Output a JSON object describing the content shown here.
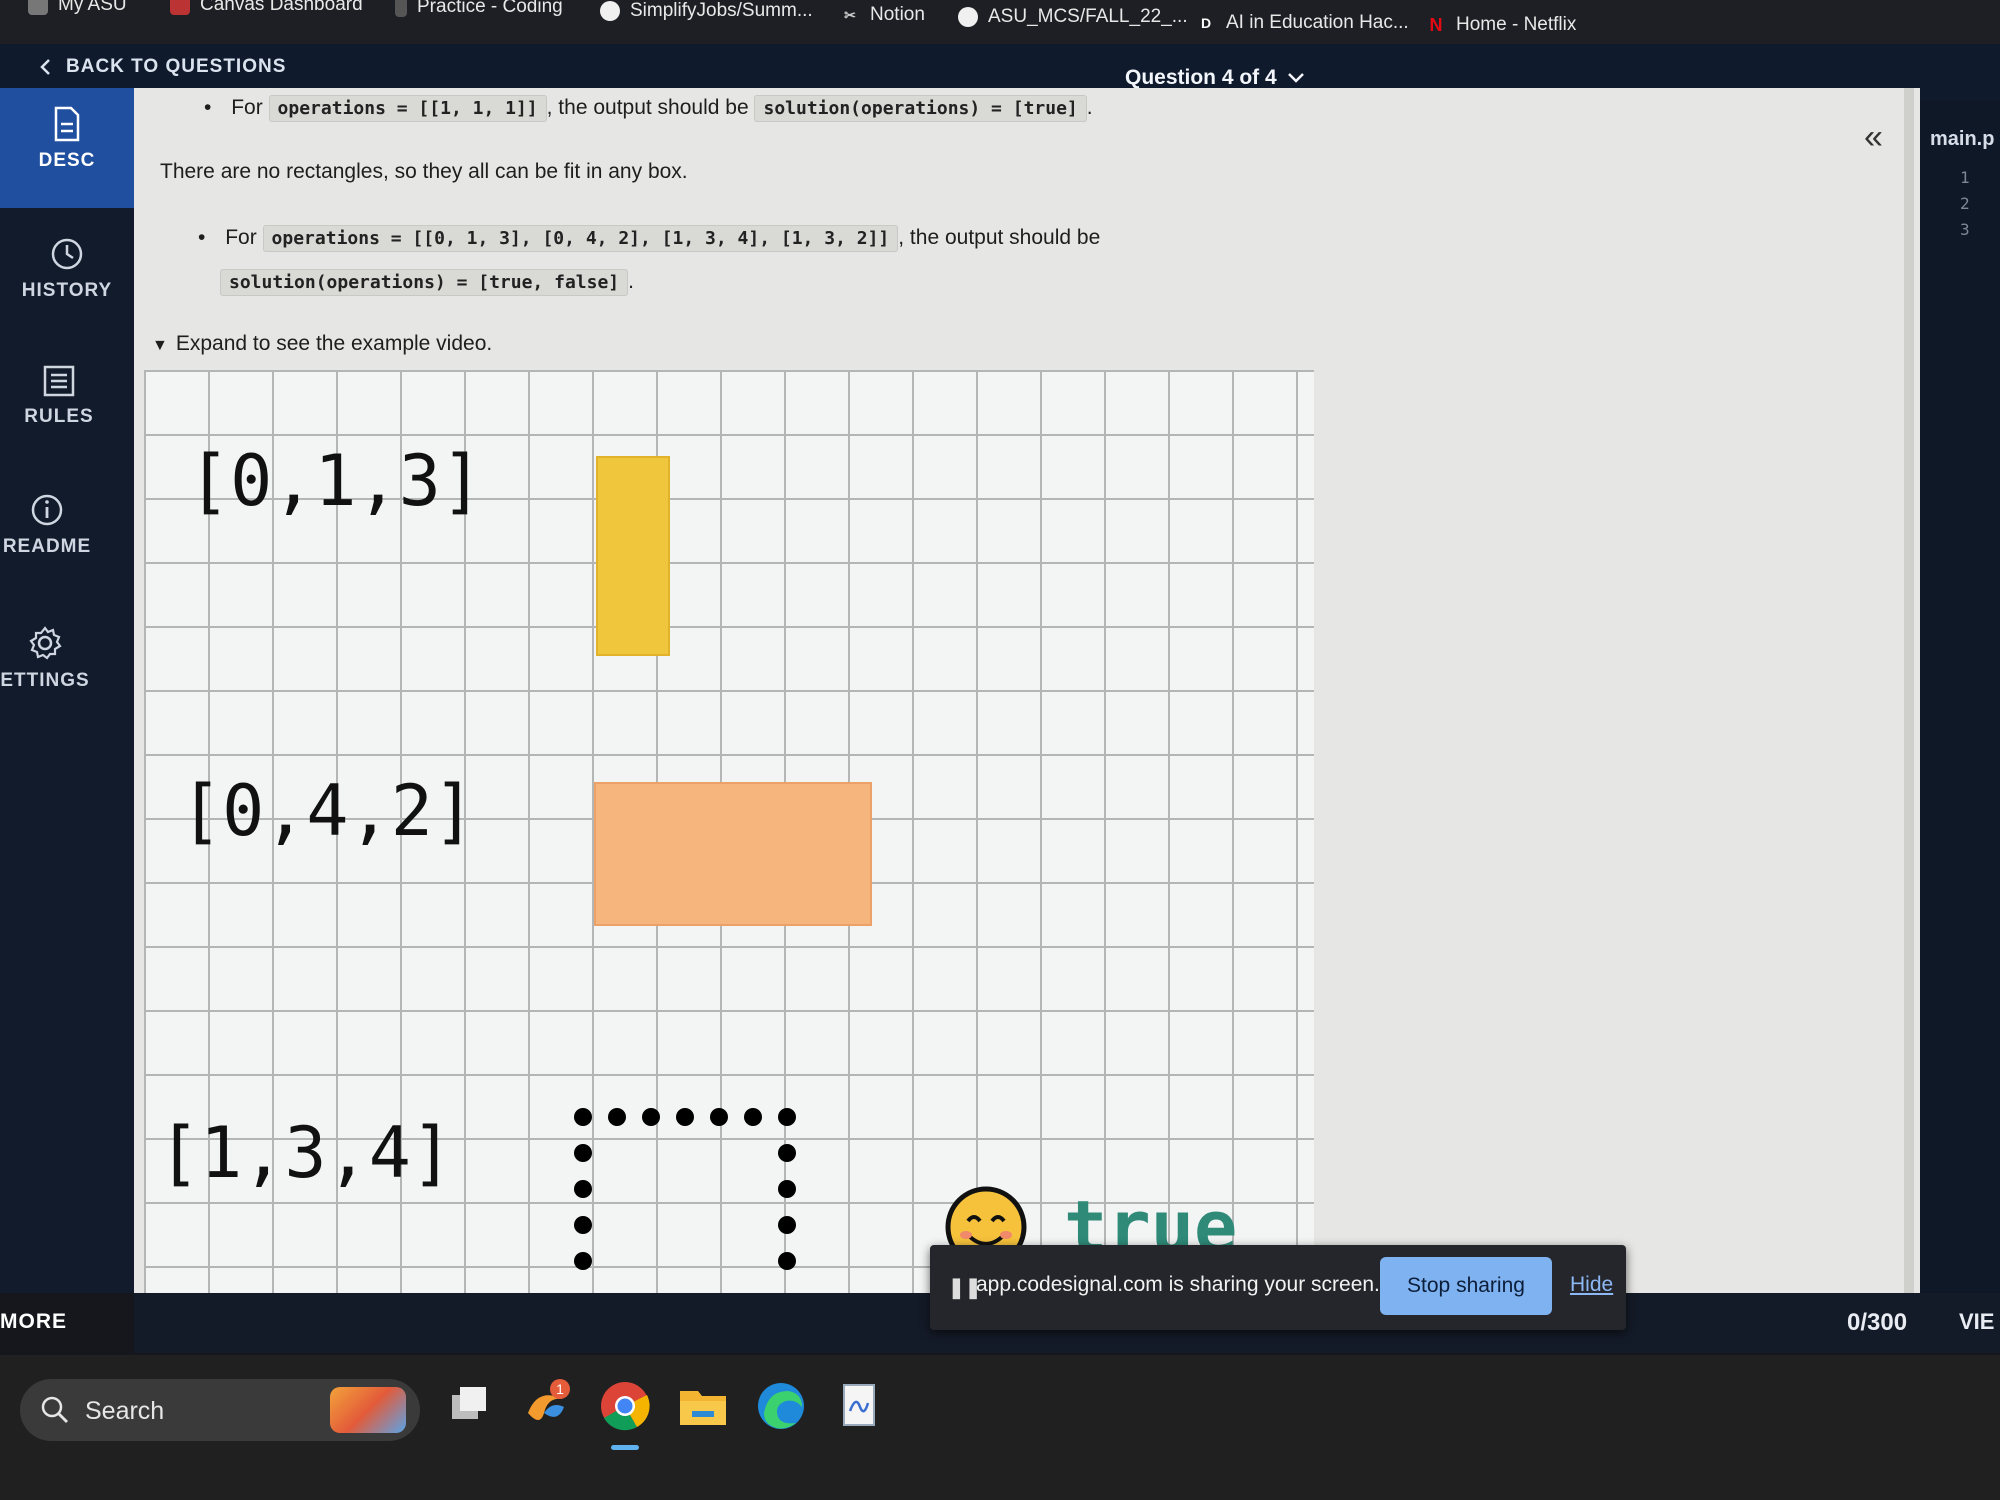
{
  "bookmarks": [
    {
      "label": "My ASU"
    },
    {
      "label": "Canvas Dashboard"
    },
    {
      "label": "Practice - Coding"
    },
    {
      "label": "SimplifyJobs/Summ..."
    },
    {
      "label": "Notion"
    },
    {
      "label": "ASU_MCS/FALL_22_..."
    },
    {
      "label": "AI in Education Hac..."
    },
    {
      "label": "Home - Netflix"
    }
  ],
  "header": {
    "back_label": "BACK TO QUESTIONS",
    "question_label": "Question 4 of 4"
  },
  "nav": {
    "desc": "DESC",
    "history": "HISTORY",
    "rules": "RULES",
    "readme": "README",
    "settings": "ETTINGS",
    "more": "MORE"
  },
  "description": {
    "ex1_prefix": "For",
    "ex1_code_var": "operations = [[1, 1, 1]]",
    "ex1_mid": ", the output should be",
    "ex1_code_result": "solution(operations) = [true]",
    "ex1_end": ".",
    "note": "There are no rectangles, so they all can be fit in any box.",
    "ex2_prefix": "For",
    "ex2_code_var": "operations = [[0, 1, 3], [0, 4, 2], [1, 3, 4], [1, 3, 2]]",
    "ex2_mid": ", the output should be",
    "ex2_code_result": "solution(operations) = [true, false]",
    "ex2_end": ".",
    "expand_label": "Expand to see the example video."
  },
  "video": {
    "op1": "[0,1,3]",
    "op2": "[0,4,2]",
    "op3": "[1,3,4]",
    "result": "true"
  },
  "editor": {
    "file_tab": "main.p",
    "line_numbers": [
      "1",
      "2",
      "3"
    ]
  },
  "share_banner": {
    "text": "app.codesignal.com is sharing your screen.",
    "stop_button": "Stop sharing",
    "hide_link": "Hide"
  },
  "footer": {
    "char_count": "0/300",
    "view": "VIE"
  },
  "taskbar": {
    "search_label": "Search",
    "notification_count": "1"
  },
  "colors": {
    "nav_active": "#1f4f9e",
    "rect_yellow": "#f0c63c",
    "rect_orange": "#f7b57e",
    "result_green": "#2f8a78",
    "stop_button": "#7fb2f0"
  }
}
